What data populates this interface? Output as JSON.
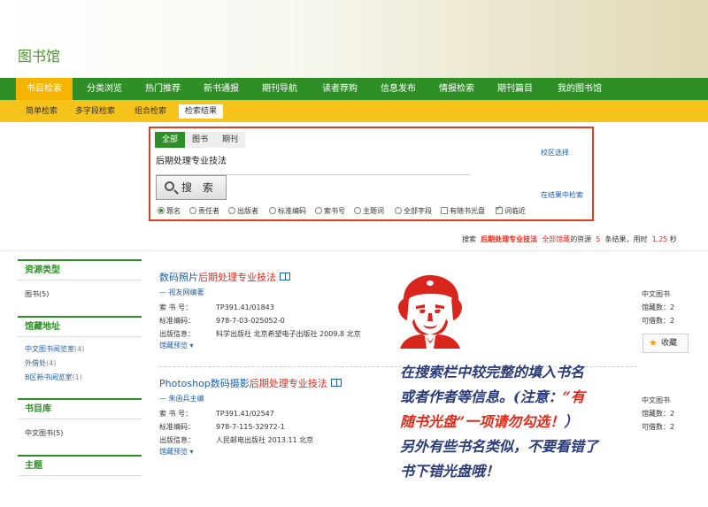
{
  "header": {
    "title": "图书馆"
  },
  "nav": {
    "items": [
      "书目检索",
      "分类浏览",
      "热门推荐",
      "新书通报",
      "期刊导航",
      "读者荐购",
      "信息发布",
      "情报检索",
      "期刊篇目",
      "我的图书馆"
    ],
    "active": "书目检索"
  },
  "subnav": {
    "items": [
      "简单检索",
      "多字段检索",
      "组合检索",
      "检索结果"
    ],
    "active": "检索结果"
  },
  "search": {
    "tabs": [
      "全部",
      "图书",
      "期刊"
    ],
    "active_tab": "全部",
    "query": "后期处理专业技法",
    "button_label": "搜 索",
    "options": [
      "题名",
      "责任者",
      "出版者",
      "标准编码",
      "索书号",
      "主题词",
      "全部字段"
    ],
    "selected_option": "题名",
    "checkbox_cd": {
      "label": "有随书光盘",
      "checked": false
    },
    "checkbox_neighbor": {
      "label": "词临近",
      "checked": true
    },
    "campus_select": "校区选择",
    "search_within": "在结果中检索"
  },
  "stats": {
    "prefix": "搜索",
    "query": "后期处理专业技法",
    "scope": "全部馆藏",
    "mid": "的资源",
    "count": "5",
    "suffix": "条结果，用时",
    "time": "1.25",
    "unit": "秒"
  },
  "facets": {
    "resource_type": {
      "title": "资源类型",
      "items": [
        {
          "label": "图书",
          "count": "(5)"
        }
      ]
    },
    "location": {
      "title": "馆藏地址",
      "items": [
        {
          "label": "中文图书阅览室",
          "count": "(4)"
        },
        {
          "label": "外借处",
          "count": "(4)"
        },
        {
          "label": "B区新书阅览室",
          "count": "(1)"
        }
      ]
    },
    "catalog": {
      "title": "书目库",
      "items": [
        {
          "label": "中文图书",
          "count": "(5)"
        }
      ]
    },
    "subject": {
      "title": "主题"
    }
  },
  "results": [
    {
      "title_prefix": "数码照片",
      "title_highlight": "后期处理专业技法",
      "author": "视友网编著",
      "call_number_label": "索 书 号：",
      "call_number": "TP391.41/01843",
      "isbn_label": "标准编码：",
      "isbn": "978-7-03-025052-0",
      "pub_label": "出版信息：",
      "pub": "科学出版社 北京希望电子出版社  2009.8  北京",
      "more": "馆藏预览",
      "type": "中文图书",
      "holdings": "馆藏数：2",
      "available": "可借数：2",
      "collect_label": "收藏"
    },
    {
      "title_prefix": "Photoshop数码摄影",
      "title_highlight": "后期处理专业技法",
      "author": "朱函兵主编",
      "call_number_label": "索 书 号：",
      "call_number": "TP391.41/02547",
      "isbn_label": "标准编码：",
      "isbn": "978-7-115-32972-1",
      "pub_label": "出版信息：",
      "pub": "人民邮电出版社  2013.11  北京",
      "more": "馆藏预览",
      "type": "中文图书",
      "holdings": "馆藏数：2",
      "available": "可借数：2"
    }
  ],
  "annotation": {
    "line1": "在搜索栏中较完整的填入书名",
    "line2_a": "或者作者等信息。(注意：",
    "line2_b": "“有",
    "line3_a": "随书光盘”一项请勿勾选！",
    "line3_b": "）",
    "line4": "另外有些书名类似，不要看错了",
    "line5": "书下错光盘哦！"
  },
  "colors": {
    "nav_green": "#2f8f27",
    "subnav_yellow": "#f6c31a",
    "highlight_red": "#e02a1a",
    "link_blue": "#1d5fa8"
  }
}
